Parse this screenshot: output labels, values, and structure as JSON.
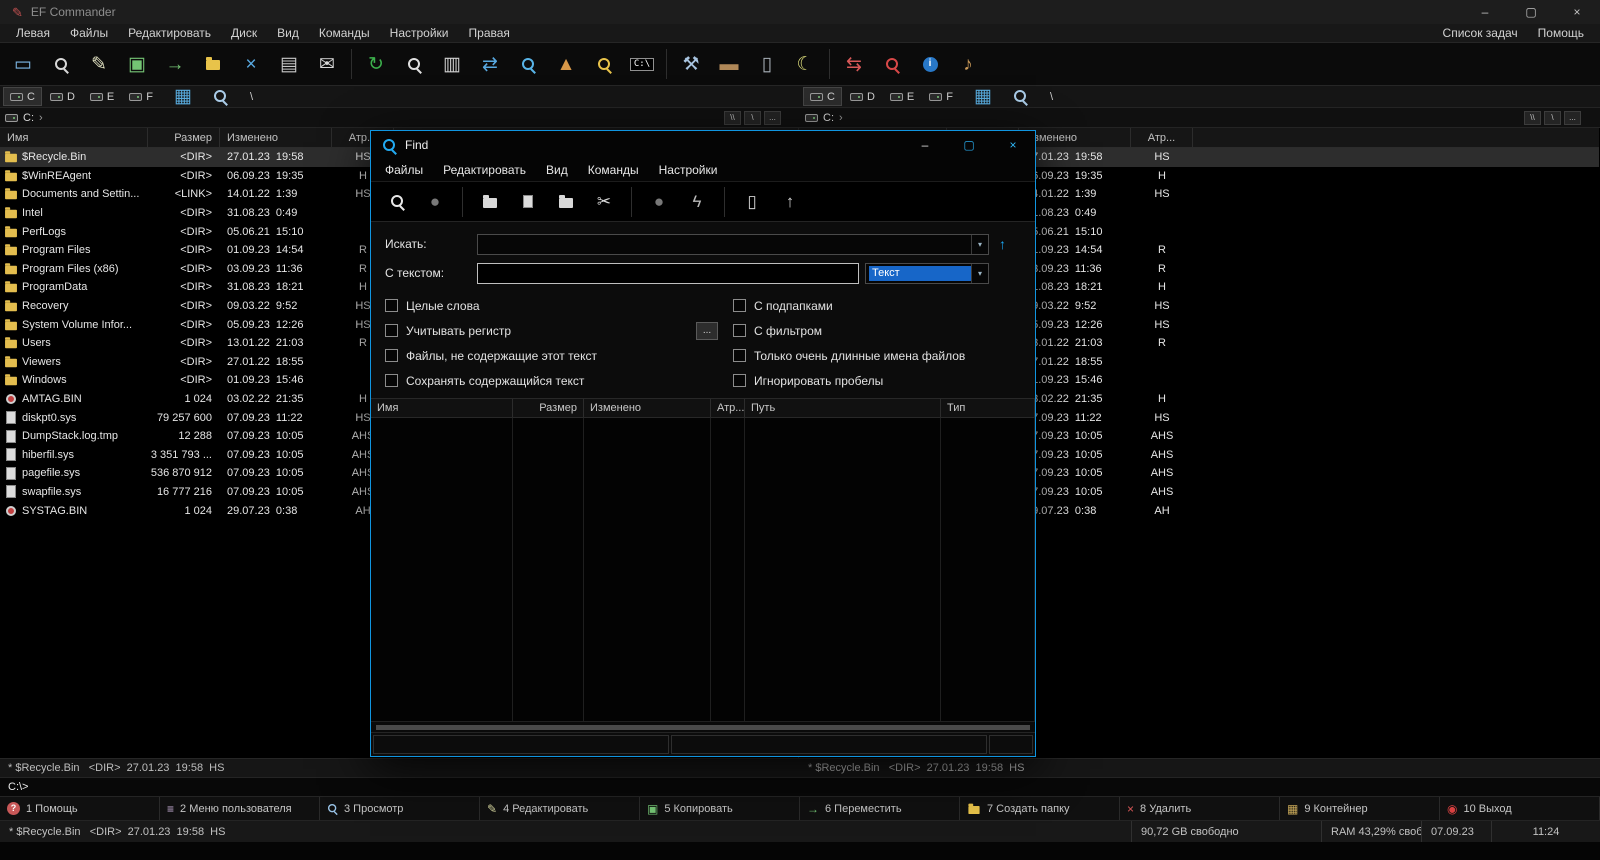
{
  "window": {
    "title": "EF Commander",
    "icon": {
      "name": "app-icon",
      "glyph": "✎"
    },
    "controls": [
      {
        "name": "minimize-button",
        "glyph": "–"
      },
      {
        "name": "maximize-button",
        "glyph": "▢"
      },
      {
        "name": "close-button",
        "glyph": "×"
      }
    ]
  },
  "menubar": {
    "left": [
      "Левая",
      "Файлы",
      "Редактировать",
      "Диск",
      "Вид",
      "Команды",
      "Настройки",
      "Правая"
    ],
    "right": [
      "Список задач",
      "Помощь"
    ]
  },
  "toolbar": {
    "icons": [
      {
        "name": "terminal-icon",
        "glyph": "▭",
        "color": "#7fb9e8"
      },
      {
        "name": "quick-view-icon",
        "kind": "mag",
        "color": "#d8d8d8"
      },
      {
        "name": "edit-icon",
        "glyph": "✎",
        "color": "#e0e0c0"
      },
      {
        "name": "copy-icon",
        "glyph": "▣",
        "color": "#74c474"
      },
      {
        "name": "move-icon",
        "glyph": "→",
        "color": "#74c474"
      },
      {
        "name": "new-folder-icon",
        "kind": "folder",
        "color": "#e8c34a"
      },
      {
        "name": "delete-icon",
        "glyph": "×",
        "color": "#58a8e0"
      },
      {
        "name": "print-icon",
        "glyph": "▤",
        "color": "#c8c8c8"
      },
      {
        "name": "mail-icon",
        "glyph": "✉",
        "color": "#d8d8d8"
      },
      {
        "kind": "sep"
      },
      {
        "name": "refresh-icon",
        "glyph": "↻",
        "color": "#3cb04c"
      },
      {
        "name": "find-icon",
        "kind": "mag",
        "color": "#e0e0e0"
      },
      {
        "name": "view-mode-icon",
        "glyph": "▥",
        "color": "#d0d0d0"
      },
      {
        "name": "sync-icon",
        "glyph": "⇄",
        "color": "#58a8e0"
      },
      {
        "name": "search-drive-icon",
        "kind": "mag",
        "color": "#58b4e8"
      },
      {
        "name": "pyramid-icon",
        "glyph": "▲",
        "color": "#d89848"
      },
      {
        "name": "search-folder-icon",
        "kind": "mag",
        "color": "#e8c34a"
      },
      {
        "name": "dos-prompt-icon",
        "kind": "dos",
        "glyph": "C:\\"
      },
      {
        "kind": "sep"
      },
      {
        "name": "tools-icon",
        "glyph": "⚒",
        "color": "#a8c4e0"
      },
      {
        "name": "vehicle-icon",
        "glyph": "▬",
        "color": "#b08858"
      },
      {
        "name": "trash-icon",
        "glyph": "▯",
        "color": "#a8b0b8"
      },
      {
        "name": "screensaver-icon",
        "glyph": "☾",
        "color": "#d8d878"
      },
      {
        "kind": "sep"
      },
      {
        "name": "sync-dirs-icon",
        "glyph": "⇆",
        "color": "#d85858"
      },
      {
        "name": "stop-search-icon",
        "kind": "mag",
        "color": "#d84848"
      },
      {
        "name": "info-icon",
        "kind": "badge",
        "glyph": "i",
        "color": "#2878c8"
      },
      {
        "name": "audio-icon",
        "glyph": "♪",
        "color": "#c89858"
      }
    ]
  },
  "drivebar": {
    "drives": [
      "C",
      "D",
      "E",
      "F"
    ],
    "active": "C",
    "extras": [
      {
        "name": "network-view-icon",
        "glyph": "▦",
        "color": "#58aadc"
      },
      {
        "name": "drive-search-icon",
        "kind": "mag",
        "color": "#aacce8"
      }
    ],
    "root_label": "\\"
  },
  "pathbar": {
    "chevron": "›",
    "buttons": [
      {
        "name": "unc-button",
        "label": "\\\\"
      },
      {
        "name": "root-button",
        "label": "\\"
      },
      {
        "name": "more-button",
        "label": "..."
      }
    ]
  },
  "panes": {
    "path_display": "C:",
    "columns": [
      "Имя",
      "Размер",
      "Изменено",
      "Атр..."
    ],
    "selection_status": "* $Recycle.Bin   <DIR>  27.01.23  19:58  HS",
    "rows": [
      {
        "icon": "folder",
        "name": "$Recycle.Bin",
        "size": "<DIR>",
        "modified": "27.01.23  19:58",
        "attr": "HS",
        "selected": true
      },
      {
        "icon": "folder",
        "name": "$WinREAgent",
        "size": "<DIR>",
        "modified": "06.09.23  19:35",
        "attr": "H"
      },
      {
        "icon": "folder",
        "name": "Documents and Settin...",
        "size": "<LINK>",
        "modified": "14.01.22  1:39",
        "attr": "HS"
      },
      {
        "icon": "folder",
        "name": "Intel",
        "size": "<DIR>",
        "modified": "31.08.23  0:49",
        "attr": ""
      },
      {
        "icon": "folder",
        "name": "PerfLogs",
        "size": "<DIR>",
        "modified": "05.06.21  15:10",
        "attr": ""
      },
      {
        "icon": "folder",
        "name": "Program Files",
        "size": "<DIR>",
        "modified": "01.09.23  14:54",
        "attr": "R"
      },
      {
        "icon": "folder",
        "name": "Program Files (x86)",
        "size": "<DIR>",
        "modified": "03.09.23  11:36",
        "attr": "R"
      },
      {
        "icon": "folder",
        "name": "ProgramData",
        "size": "<DIR>",
        "modified": "31.08.23  18:21",
        "attr": "H"
      },
      {
        "icon": "folder",
        "name": "Recovery",
        "size": "<DIR>",
        "modified": "09.03.22  9:52",
        "attr": "HS"
      },
      {
        "icon": "folder",
        "name": "System Volume Infor...",
        "size": "<DIR>",
        "modified": "05.09.23  12:26",
        "attr": "HS"
      },
      {
        "icon": "folder",
        "name": "Users",
        "size": "<DIR>",
        "modified": "13.01.22  21:03",
        "attr": "R"
      },
      {
        "icon": "folder",
        "name": "Viewers",
        "size": "<DIR>",
        "modified": "27.01.22  18:55",
        "attr": ""
      },
      {
        "icon": "folder",
        "name": "Windows",
        "size": "<DIR>",
        "modified": "01.09.23  15:46",
        "attr": ""
      },
      {
        "icon": "disc",
        "name": "AMTAG.BIN",
        "size": "1 024",
        "modified": "03.02.22  21:35",
        "attr": "H"
      },
      {
        "icon": "page",
        "name": "diskpt0.sys",
        "size": "79 257 600",
        "modified": "07.09.23  11:22",
        "attr": "HS"
      },
      {
        "icon": "page",
        "name": "DumpStack.log.tmp",
        "size": "12 288",
        "modified": "07.09.23  10:05",
        "attr": "AHS"
      },
      {
        "icon": "page",
        "name": "hiberfil.sys",
        "size": "3 351 793 ...",
        "modified": "07.09.23  10:05",
        "attr": "AHS"
      },
      {
        "icon": "page",
        "name": "pagefile.sys",
        "size": "536 870 912",
        "modified": "07.09.23  10:05",
        "attr": "AHS"
      },
      {
        "icon": "page",
        "name": "swapfile.sys",
        "size": "16 777 216",
        "modified": "07.09.23  10:05",
        "attr": "AHS"
      },
      {
        "icon": "disc",
        "name": "SYSTAG.BIN",
        "size": "1 024",
        "modified": "29.07.23  0:38",
        "attr": "AH"
      }
    ]
  },
  "find_dialog": {
    "title": "Find",
    "accent_color": "#1095e0",
    "controls": [
      {
        "name": "minimize-button",
        "glyph": "–",
        "color": "#e0e0e0"
      },
      {
        "name": "maximize-button",
        "glyph": "▢",
        "color": "#28a8e8"
      },
      {
        "name": "close-button",
        "glyph": "×",
        "color": "#30b8f8"
      }
    ],
    "menu": [
      "Файлы",
      "Редактировать",
      "Вид",
      "Команды",
      "Настройки"
    ],
    "toolbar_icons": [
      {
        "name": "start-search-icon",
        "kind": "mag",
        "color": "#e8e8e8"
      },
      {
        "name": "stop-search-icon",
        "glyph": "●",
        "color": "#787878"
      },
      {
        "kind": "sep"
      },
      {
        "name": "goto-folder-icon",
        "kind": "folder",
        "color": "#d8d8d8"
      },
      {
        "name": "view-file-icon",
        "kind": "page"
      },
      {
        "name": "open-folder-icon",
        "kind": "folder",
        "color": "#d8d8d8"
      },
      {
        "name": "cut-icon",
        "glyph": "✂",
        "color": "#d8d8d8"
      },
      {
        "kind": "sep"
      },
      {
        "name": "feed-icon",
        "glyph": "●",
        "color": "#787878"
      },
      {
        "name": "lightning-icon",
        "glyph": "ϟ",
        "color": "#b8b8b8"
      },
      {
        "kind": "sep"
      },
      {
        "name": "container-icon",
        "glyph": "▯",
        "color": "#d0d0d0"
      },
      {
        "name": "move-up-icon",
        "glyph": "↑",
        "color": "#d0d0d0"
      }
    ],
    "fields": {
      "search_label": "Искать:",
      "search_value": "",
      "text_label": "С текстом:",
      "text_value": "",
      "text_type_value": "Текст"
    },
    "dropdown_glyph": "▾",
    "up_icon": {
      "name": "history-up-icon",
      "glyph": "↑"
    },
    "filter_button": "...",
    "checkboxes_left": [
      {
        "label": "Целые слова",
        "checked": false
      },
      {
        "label": "Учитывать регистр",
        "checked": false
      },
      {
        "label": "Файлы, не содержащие этот текст",
        "checked": false
      },
      {
        "label": "Сохранять содержащийся текст",
        "checked": false
      }
    ],
    "checkboxes_right": [
      {
        "label": "С подпапками",
        "checked": false
      },
      {
        "label": "С фильтром",
        "checked": false
      },
      {
        "label": "Только очень длинные имена файлов",
        "checked": false
      },
      {
        "label": "Игнорировать пробелы",
        "checked": false
      }
    ],
    "results": {
      "columns": [
        "Имя",
        "Размер",
        "Изменено",
        "Атр...",
        "Путь",
        "Тип"
      ]
    }
  },
  "cmdline": {
    "prompt": "C:\\>"
  },
  "function_keys": [
    {
      "key": "1",
      "label": "Помощь",
      "icon": {
        "name": "help-icon",
        "kind": "badge",
        "glyph": "?",
        "color": "#c85858"
      }
    },
    {
      "key": "2",
      "label": "Меню пользователя",
      "icon": {
        "name": "user-menu-icon",
        "glyph": "≡",
        "color": "#c8b0d8"
      }
    },
    {
      "key": "3",
      "label": "Просмотр",
      "icon": {
        "name": "view-icon",
        "kind": "mag",
        "color": "#9ac4e8"
      }
    },
    {
      "key": "4",
      "label": "Редактировать",
      "icon": {
        "name": "edit-icon",
        "glyph": "✎",
        "color": "#d8d8a0"
      }
    },
    {
      "key": "5",
      "label": "Копировать",
      "icon": {
        "name": "copy-icon",
        "glyph": "▣",
        "color": "#74c474"
      }
    },
    {
      "key": "6",
      "label": "Переместить",
      "icon": {
        "name": "move-icon",
        "glyph": "→",
        "color": "#74c474"
      }
    },
    {
      "key": "7",
      "label": "Создать папку",
      "icon": {
        "name": "new-folder-icon",
        "kind": "folder",
        "color": "#e8c34a"
      }
    },
    {
      "key": "8",
      "label": "Удалить",
      "icon": {
        "name": "delete-icon",
        "glyph": "×",
        "color": "#d85858"
      }
    },
    {
      "key": "9",
      "label": "Контейнер",
      "icon": {
        "name": "container-icon",
        "glyph": "▦",
        "color": "#c8a858"
      }
    },
    {
      "key": "10",
      "label": "Выход",
      "icon": {
        "name": "exit-icon",
        "glyph": "◉",
        "color": "#d84040"
      }
    }
  ],
  "statusbar": {
    "selection": "* $Recycle.Bin   <DIR>  27.01.23  19:58  HS",
    "free_space": "90,72 GB свободно",
    "ram": "RAM 43,29% своб...",
    "date": "07.09.23",
    "time": "11:24"
  }
}
